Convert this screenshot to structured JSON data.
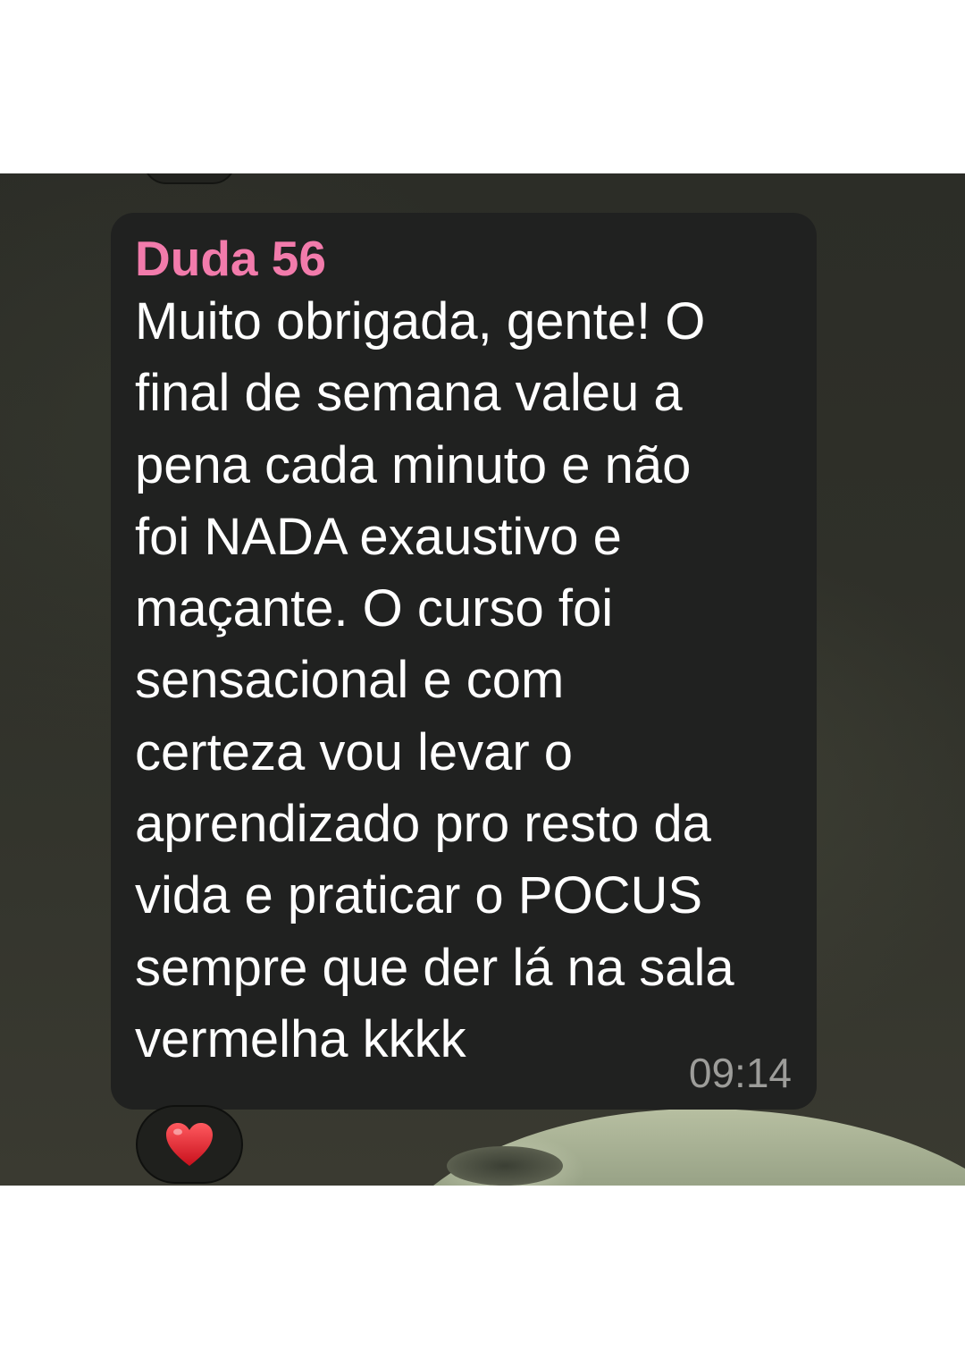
{
  "message": {
    "sender": "Duda 56",
    "lines": [
      "Muito obrigada, gente! O",
      "final de semana valeu a",
      "pena cada minuto e não",
      "foi NADA exaustivo e",
      "maçante. O curso foi",
      "sensacional e com",
      "certeza vou levar o",
      "aprendizado pro resto da",
      "vida e praticar o POCUS",
      "sempre que der lá na sala",
      "vermelha kkkk"
    ],
    "time": "09:14"
  },
  "reaction": {
    "icon": "heart-icon"
  },
  "colors": {
    "sender": "#f27bab",
    "bubble": "#202120",
    "text": "#ffffff",
    "timestamp": "#9d9d9a",
    "heart": "#e0242f"
  }
}
